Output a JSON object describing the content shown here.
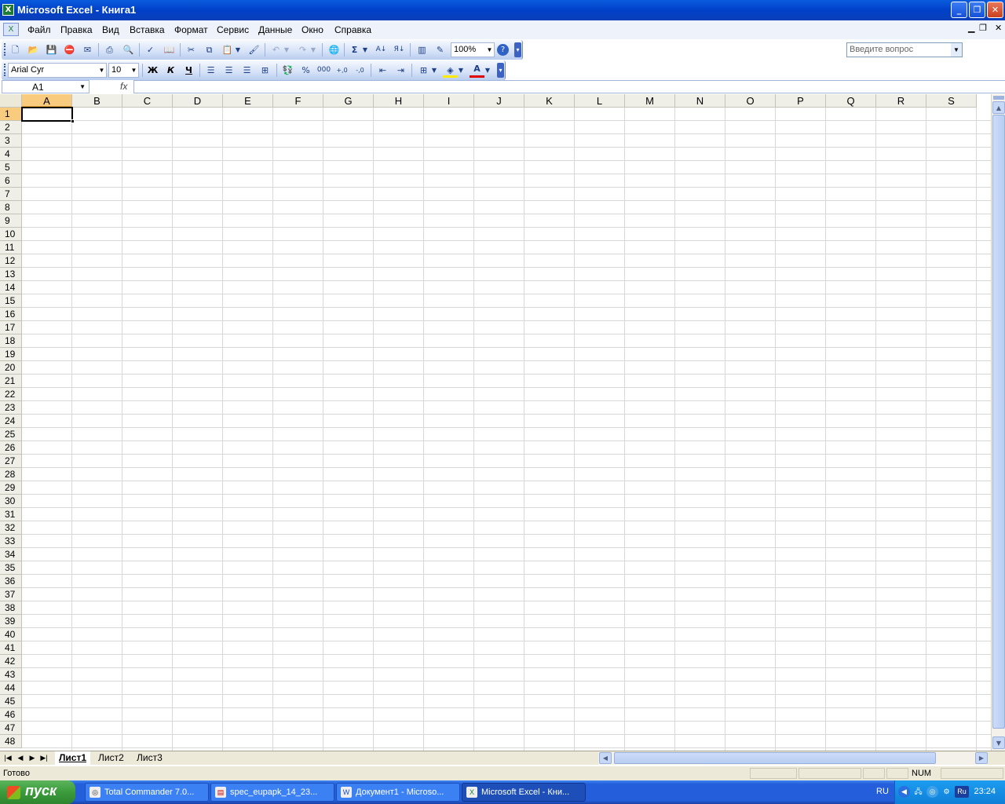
{
  "window": {
    "title": "Microsoft Excel - Книга1",
    "min": "_",
    "max": "❐",
    "close": "✕"
  },
  "menu": {
    "items": [
      "Файл",
      "Правка",
      "Вид",
      "Вставка",
      "Формат",
      "Сервис",
      "Данные",
      "Окно",
      "Справка"
    ],
    "ask_placeholder": "Введите вопрос"
  },
  "toolbar": {
    "zoom": "100%",
    "font": "Arial Cyr",
    "size": "10",
    "bold": "Ж",
    "italic": "К",
    "underline": "Ч",
    "percent": "%",
    "thousands": "000",
    "sum": "Σ"
  },
  "formula_bar": {
    "name_box": "A1",
    "fx": "fx",
    "value": ""
  },
  "sheet": {
    "active_cell": "A1",
    "columns": [
      "A",
      "B",
      "C",
      "D",
      "E",
      "F",
      "G",
      "H",
      "I",
      "J",
      "K",
      "L",
      "M",
      "N",
      "O",
      "P",
      "Q",
      "R",
      "S"
    ],
    "rows": [
      "1",
      "2",
      "3",
      "4",
      "5",
      "6",
      "7",
      "8",
      "9",
      "10",
      "11",
      "12",
      "13",
      "14",
      "15",
      "16",
      "17",
      "18",
      "19",
      "20",
      "21",
      "22",
      "23",
      "24",
      "25",
      "26",
      "27",
      "28",
      "29",
      "30",
      "31",
      "32",
      "33",
      "34",
      "35",
      "36",
      "37",
      "38",
      "39",
      "40",
      "41",
      "42",
      "43",
      "44",
      "45",
      "46",
      "47",
      "48"
    ],
    "tabs": [
      "Лист1",
      "Лист2",
      "Лист3"
    ],
    "active_tab": "Лист1"
  },
  "status": {
    "text": "Готово",
    "num": "NUM"
  },
  "taskbar": {
    "start": "пуск",
    "tasks": [
      "Total Commander 7.0...",
      "spec_eupapk_14_23...",
      "Документ1 - Microso...",
      "Microsoft Excel - Кни..."
    ],
    "lang": "RU",
    "tray_lang": "Ru",
    "clock": "23:24"
  }
}
